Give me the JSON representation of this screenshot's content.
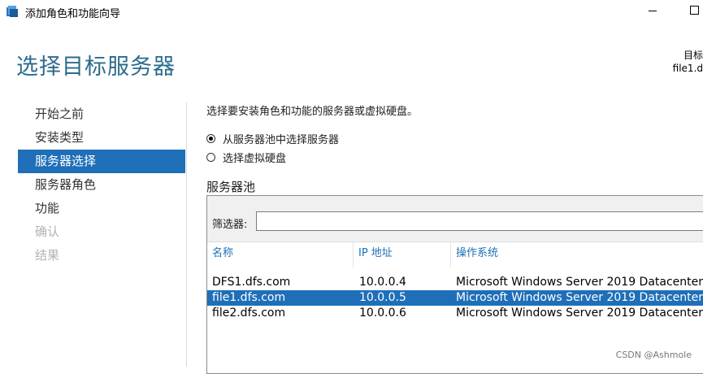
{
  "window": {
    "title": "添加角色和功能向导",
    "icon": "server-wizard-icon"
  },
  "page_title": "选择目标服务器",
  "target": {
    "line1": "目标",
    "line2": "file1.d"
  },
  "nav": {
    "items": [
      {
        "label": "开始之前",
        "state": "normal"
      },
      {
        "label": "安装类型",
        "state": "normal"
      },
      {
        "label": "服务器选择",
        "state": "active"
      },
      {
        "label": "服务器角色",
        "state": "normal"
      },
      {
        "label": "功能",
        "state": "normal"
      },
      {
        "label": "确认",
        "state": "disabled"
      },
      {
        "label": "结果",
        "state": "disabled"
      }
    ]
  },
  "instruction": "选择要安装角色和功能的服务器或虚拟硬盘。",
  "options": [
    {
      "label": "从服务器池中选择服务器",
      "checked": true
    },
    {
      "label": "选择虚拟硬盘",
      "checked": false
    }
  ],
  "pool": {
    "heading": "服务器池",
    "filter_label": "筛选器:",
    "filter_value": "",
    "columns": [
      "名称",
      "IP 地址",
      "操作系统"
    ],
    "rows": [
      {
        "name": "DFS1.dfs.com",
        "ip": "10.0.0.4",
        "os": "Microsoft Windows Server 2019 Datacenter",
        "selected": false
      },
      {
        "name": "file1.dfs.com",
        "ip": "10.0.0.5",
        "os": "Microsoft Windows Server 2019 Datacenter",
        "selected": true
      },
      {
        "name": "file2.dfs.com",
        "ip": "10.0.0.6",
        "os": "Microsoft Windows Server 2019 Datacenter",
        "selected": false
      }
    ]
  },
  "watermark": "CSDN @Ashmole",
  "colors": {
    "accent": "#1f6fb8",
    "title": "#2b6b8c",
    "disabled": "#b3b3b3"
  }
}
